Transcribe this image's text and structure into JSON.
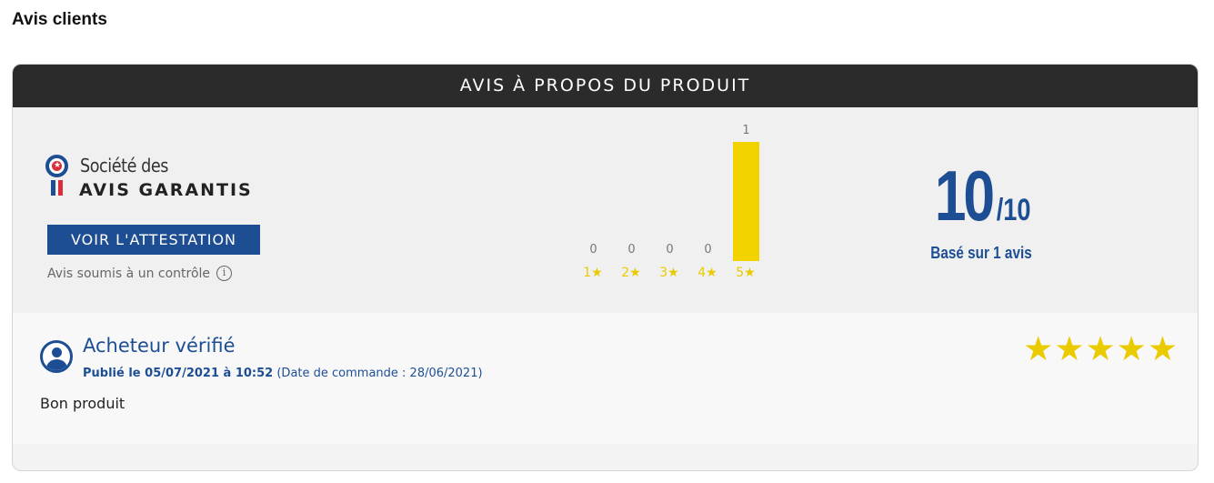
{
  "page": {
    "title": "Avis clients"
  },
  "card": {
    "header": "AVIS À PROPOS DU PRODUIT"
  },
  "logo": {
    "line1": "Société des",
    "line2": "AVIS GARANTIS"
  },
  "attestation": {
    "button_label": "VOIR L'ATTESTATION",
    "control_text": "Avis soumis à un contrôle",
    "info_glyph": "i"
  },
  "histogram": {
    "bars": [
      {
        "label": "1★",
        "count": 0
      },
      {
        "label": "2★",
        "count": 0
      },
      {
        "label": "3★",
        "count": 0
      },
      {
        "label": "4★",
        "count": 0
      },
      {
        "label": "5★",
        "count": 1
      }
    ],
    "bar_color": "#f2d300"
  },
  "score": {
    "value": "10",
    "max": "/10",
    "based_on": "Basé sur 1 avis"
  },
  "review": {
    "author": "Acheteur vérifié",
    "published": "Publié le 05/07/2021 à 10:52",
    "order_date": "(Date de commande : 28/06/2021)",
    "text": "Bon produit",
    "stars": [
      "★",
      "★",
      "★",
      "★",
      "★"
    ],
    "rating": 5
  },
  "colors": {
    "brand_blue": "#1d4e94",
    "star_yellow": "#eacb00",
    "header_dark": "#2b2b2b",
    "logo_red": "#d92d3a"
  }
}
